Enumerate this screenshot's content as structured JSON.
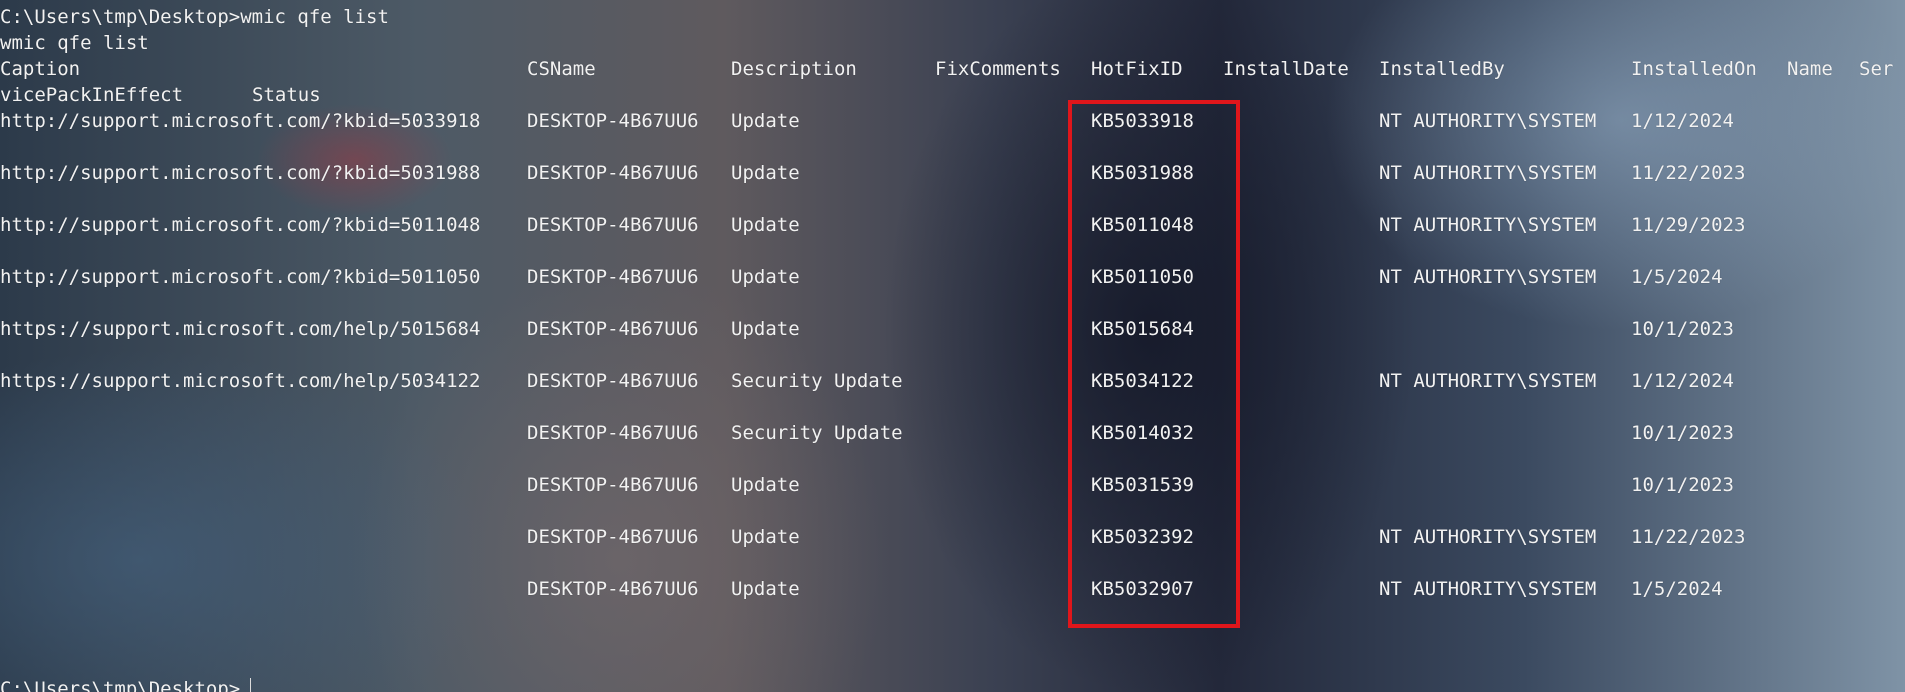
{
  "terminal": {
    "command_line": "C:\\Users\\tmp\\Desktop>wmic qfe list",
    "echo_line": "wmic qfe list",
    "final_prompt": "C:\\Users\\tmp\\Desktop>",
    "highlight_color": "#e0161b",
    "columns": {
      "caption": "Caption",
      "csname": "CSName",
      "description": "Description",
      "fix_comments": "FixComments",
      "hotfix_id": "HotFixID",
      "install_date": "InstallDate",
      "installed_by": "InstalledBy",
      "installed_on": "InstalledOn",
      "name": "Name",
      "service_pack_head": "Ser",
      "service_pack_tail": "vicePackInEffect",
      "status": "Status"
    },
    "rows": [
      {
        "caption": "http://support.microsoft.com/?kbid=5033918",
        "csname": "DESKTOP-4B67UU6",
        "description": "Update",
        "hotfix_id": "KB5033918",
        "installed_by": "NT AUTHORITY\\SYSTEM",
        "installed_on": "1/12/2024"
      },
      {
        "caption": "http://support.microsoft.com/?kbid=5031988",
        "csname": "DESKTOP-4B67UU6",
        "description": "Update",
        "hotfix_id": "KB5031988",
        "installed_by": "NT AUTHORITY\\SYSTEM",
        "installed_on": "11/22/2023"
      },
      {
        "caption": "http://support.microsoft.com/?kbid=5011048",
        "csname": "DESKTOP-4B67UU6",
        "description": "Update",
        "hotfix_id": "KB5011048",
        "installed_by": "NT AUTHORITY\\SYSTEM",
        "installed_on": "11/29/2023"
      },
      {
        "caption": "http://support.microsoft.com/?kbid=5011050",
        "csname": "DESKTOP-4B67UU6",
        "description": "Update",
        "hotfix_id": "KB5011050",
        "installed_by": "NT AUTHORITY\\SYSTEM",
        "installed_on": "1/5/2024"
      },
      {
        "caption": "https://support.microsoft.com/help/5015684",
        "csname": "DESKTOP-4B67UU6",
        "description": "Update",
        "hotfix_id": "KB5015684",
        "installed_by": "",
        "installed_on": "10/1/2023"
      },
      {
        "caption": "https://support.microsoft.com/help/5034122",
        "csname": "DESKTOP-4B67UU6",
        "description": "Security Update",
        "hotfix_id": "KB5034122",
        "installed_by": "NT AUTHORITY\\SYSTEM",
        "installed_on": "1/12/2024"
      },
      {
        "caption": "",
        "csname": "DESKTOP-4B67UU6",
        "description": "Security Update",
        "hotfix_id": "KB5014032",
        "installed_by": "",
        "installed_on": "10/1/2023"
      },
      {
        "caption": "",
        "csname": "DESKTOP-4B67UU6",
        "description": "Update",
        "hotfix_id": "KB5031539",
        "installed_by": "",
        "installed_on": "10/1/2023"
      },
      {
        "caption": "",
        "csname": "DESKTOP-4B67UU6",
        "description": "Update",
        "hotfix_id": "KB5032392",
        "installed_by": "NT AUTHORITY\\SYSTEM",
        "installed_on": "11/22/2023"
      },
      {
        "caption": "",
        "csname": "DESKTOP-4B67UU6",
        "description": "Update",
        "hotfix_id": "KB5032907",
        "installed_by": "NT AUTHORITY\\SYSTEM",
        "installed_on": "1/5/2024"
      }
    ]
  }
}
